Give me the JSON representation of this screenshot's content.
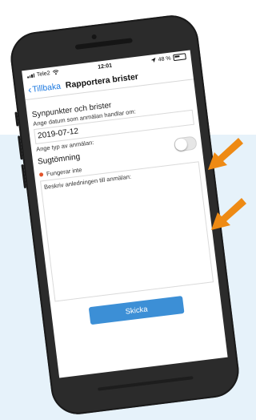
{
  "colors": {
    "background_band": "#e6f2fa",
    "arrow": "#ee8a14",
    "link_blue": "#1e7ae0",
    "submit_blue": "#3c8fd6",
    "status_dot": "#e2542b"
  },
  "status_bar": {
    "carrier": "Tele2",
    "time": "12:01",
    "battery": "48 %"
  },
  "nav": {
    "back_label": "Tillbaka",
    "title": "Rapportera brister"
  },
  "form": {
    "section_title": "Synpunkter och brister",
    "date_label": "Ange datum som anmälan handlar om:",
    "date_value": "2019-07-12",
    "type_label": "Ange typ av anmälan:",
    "type_value": "Sugtömning",
    "toggle_on": false,
    "status_text": "Fungerar inte",
    "description_label": "Beskriv anledningen till anmälan:",
    "submit_label": "Skicka"
  },
  "icons": [
    "wifi-icon",
    "location-arrow-icon",
    "battery-icon",
    "chevron-left-icon",
    "arrow-icon"
  ]
}
